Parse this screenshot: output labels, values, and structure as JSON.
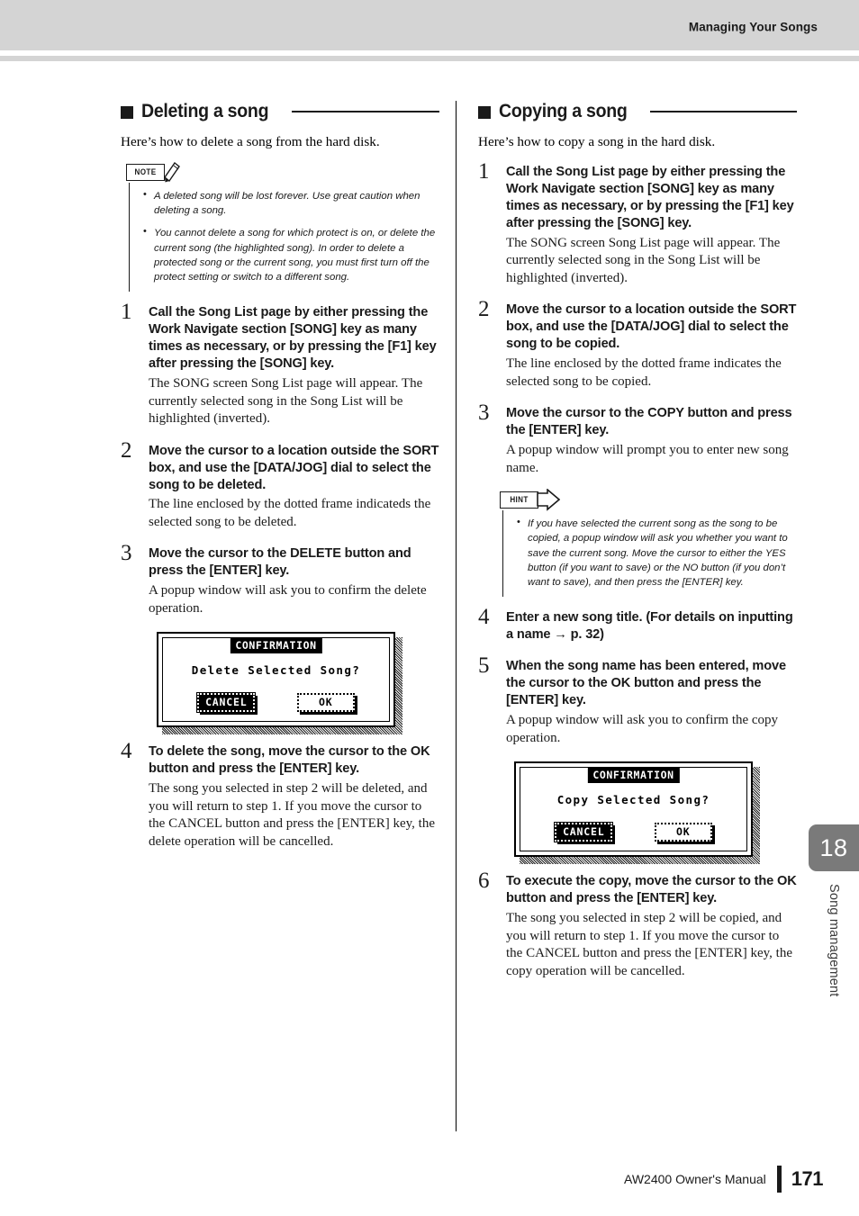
{
  "header": {
    "title": "Managing Your Songs"
  },
  "footer": {
    "manual": "AW2400  Owner's Manual",
    "page_number": "171"
  },
  "chapter_tab": {
    "number": "18",
    "label": "Song management"
  },
  "left_column": {
    "section_title": "Deleting a song",
    "intro": "Here’s how to delete a song from the hard disk.",
    "note": {
      "tag": "NOTE",
      "icon": "pencil-icon",
      "items": [
        "A deleted song will be lost forever. Use great caution when deleting a song.",
        "You cannot delete a song for which protect is on, or delete the current song (the highlighted song). In order to delete a protected song or the current song, you must first turn off the protect setting or switch to a different song."
      ]
    },
    "steps": [
      {
        "num": "1",
        "head": "Call the Song List page by either pressing the Work Navigate section [SONG] key as many times as necessary, or by pressing the [F1] key after pressing the [SONG] key.",
        "body": "The SONG screen Song List page will appear. The currently selected song in the Song List will be highlighted (inverted)."
      },
      {
        "num": "2",
        "head": "Move the cursor to a location outside the SORT box, and use the [DATA/JOG] dial to select the song to be deleted.",
        "body": "The line enclosed by the dotted frame indicateds the selected song to be deleted."
      },
      {
        "num": "3",
        "head": "Move the cursor to the DELETE button and press the [ENTER] key.",
        "body": "A popup window will ask you to confirm the delete operation."
      },
      {
        "num": "4",
        "head": "To delete the song, move the cursor to the OK button and press the [ENTER] key.",
        "body": "The song you selected in step 2 will be deleted, and you will return to step 1. If you move the cursor to the CANCEL button and press the [ENTER] key, the delete operation will be cancelled."
      }
    ],
    "lcd": {
      "title": "CONFIRMATION",
      "message": "Delete Selected Song?",
      "cancel_label": "CANCEL",
      "ok_label": "OK"
    }
  },
  "right_column": {
    "section_title": "Copying a song",
    "intro": "Here’s how to copy a song in the hard disk.",
    "hint": {
      "tag": "HINT",
      "icon": "arrow-icon",
      "items": [
        "If you have selected the current song as the song to be copied, a popup window will ask you whether you want to save the current song. Move the cursor to either the YES button (if you want to save) or the NO button (if you don’t want to save), and then press the [ENTER] key."
      ]
    },
    "steps": [
      {
        "num": "1",
        "head": "Call the Song List page by either pressing the Work Navigate section [SONG] key as many times as necessary, or by pressing the [F1] key after pressing the [SONG] key.",
        "body": "The SONG screen Song List page will appear. The currently selected song in the Song List will be highlighted (inverted)."
      },
      {
        "num": "2",
        "head": "Move the cursor to a location outside the SORT box, and use the [DATA/JOG] dial to select the song to be copied.",
        "body": "The line enclosed by the dotted frame indicates the selected song to be copied."
      },
      {
        "num": "3",
        "head": "Move the cursor to the COPY button and press the [ENTER] key.",
        "body": "A popup window will prompt you to enter new song name."
      },
      {
        "num": "4",
        "head": "Enter a new song title. (For details on inputting a name → p. 32)",
        "body": ""
      },
      {
        "num": "5",
        "head": "When the song name has been entered, move the cursor to the OK button and press the [ENTER] key.",
        "body": "A popup window will ask you to confirm the copy operation."
      },
      {
        "num": "6",
        "head": "To execute the copy, move the cursor to the OK button and press the [ENTER] key.",
        "body": "The song you selected in step 2 will be copied, and you will return to step 1. If you move the cursor to the CANCEL button and press the [ENTER] key, the copy operation will be cancelled."
      }
    ],
    "lcd": {
      "title": "CONFIRMATION",
      "message": "Copy Selected Song?",
      "cancel_label": "CANCEL",
      "ok_label": "OK"
    }
  }
}
